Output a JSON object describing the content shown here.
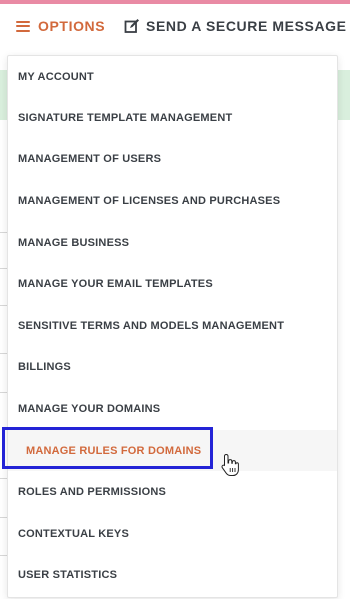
{
  "topbar": {
    "options_label": "OPTIONS",
    "secure_message_label": "SEND A SECURE MESSAGE",
    "accent_color": "#d2693c",
    "top_stripe_color": "#e98aa4"
  },
  "menu": {
    "items": [
      {
        "label": "MY ACCOUNT"
      },
      {
        "label": "SIGNATURE TEMPLATE MANAGEMENT"
      },
      {
        "label": "MANAGEMENT OF USERS"
      },
      {
        "label": "MANAGEMENT OF LICENSES AND PURCHASES"
      },
      {
        "label": "MANAGE BUSINESS"
      },
      {
        "label": "MANAGE YOUR EMAIL TEMPLATES"
      },
      {
        "label": "SENSITIVE TERMS AND MODELS MANAGEMENT"
      },
      {
        "label": "BILLINGS"
      },
      {
        "label": "MANAGE YOUR DOMAINS"
      },
      {
        "label": "MANAGE RULES FOR DOMAINS",
        "active": true
      },
      {
        "label": "ROLES AND PERMISSIONS"
      },
      {
        "label": "CONTEXTUAL KEYS"
      },
      {
        "label": "USER STATISTICS"
      }
    ],
    "focus_color": "#2323d6"
  },
  "icons": {
    "hamburger": "hamburger-menu-icon",
    "edit": "edit-message-icon",
    "cursor": "hand-pointer-cursor-icon"
  }
}
